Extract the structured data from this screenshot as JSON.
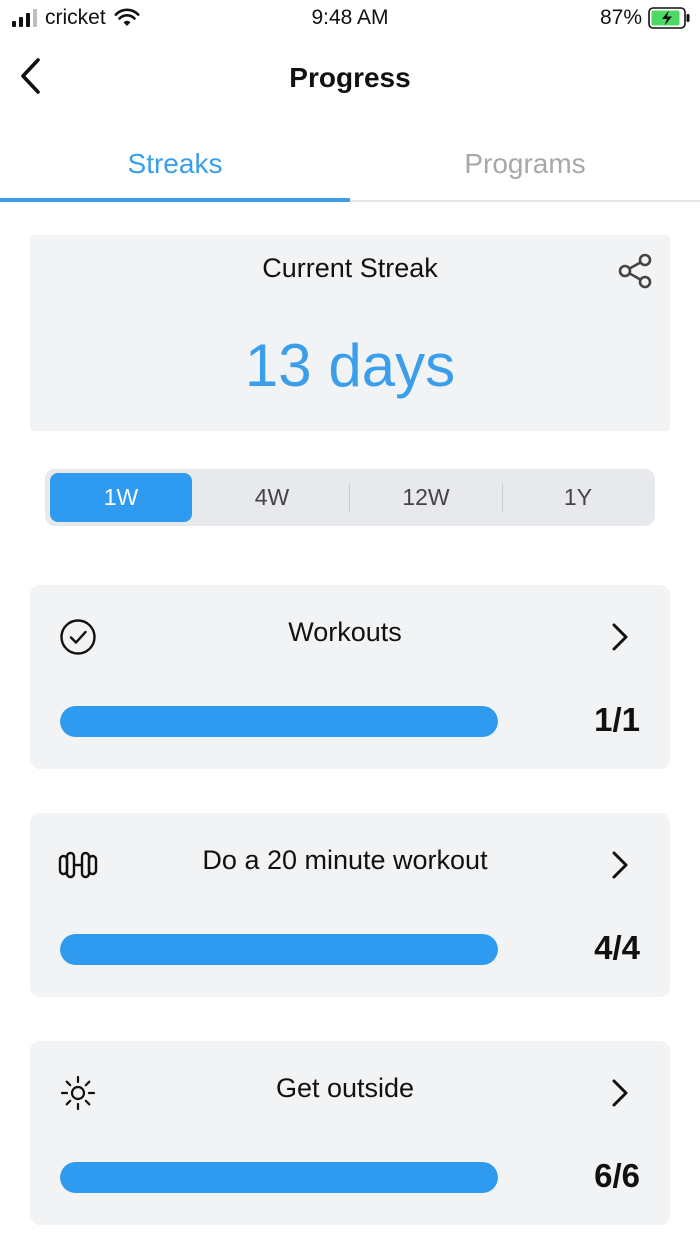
{
  "status_bar": {
    "carrier": "cricket",
    "time": "9:48 AM",
    "battery_percent": "87%",
    "icons": [
      "signal-icon",
      "wifi-icon",
      "battery-charging-icon"
    ]
  },
  "header": {
    "title": "Progress",
    "back_icon": "chevron-left-icon"
  },
  "tabs": [
    {
      "label": "Streaks",
      "active": true
    },
    {
      "label": "Programs",
      "active": false
    }
  ],
  "streak": {
    "label": "Current Streak",
    "value": "13 days",
    "share_icon": "share-icon"
  },
  "range_selector": {
    "options": [
      "1W",
      "4W",
      "12W",
      "1Y"
    ],
    "selected": "1W"
  },
  "goals": [
    {
      "title": "Workouts",
      "count": "1/1",
      "progress": 1.0,
      "icon": "check-circle-icon"
    },
    {
      "title": "Do a 20 minute workout",
      "count": "4/4",
      "progress": 1.0,
      "icon": "dumbbell-icon"
    },
    {
      "title": "Get outside",
      "count": "6/6",
      "progress": 1.0,
      "icon": "sun-icon"
    }
  ],
  "colors": {
    "accent": "#3b9eea",
    "progress_fill": "#2f9bf0",
    "card_background": "#f1f3f5",
    "inactive_tab": "#a8a8a8"
  }
}
